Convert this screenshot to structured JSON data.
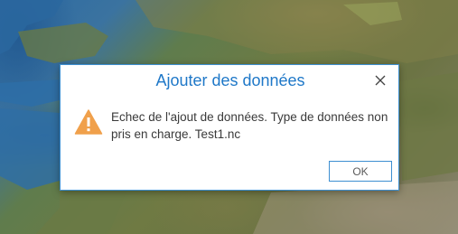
{
  "dialog": {
    "title": "Ajouter des données",
    "message": "Echec de l'ajout de données. Type de données non pris en charge. Test1.nc",
    "ok_label": "OK",
    "close_icon": "close-icon",
    "warning_icon": "warning-icon"
  },
  "colors": {
    "title": "#1f78c8",
    "accent_border": "#3d8fd1",
    "warning": "#f0a04b"
  }
}
